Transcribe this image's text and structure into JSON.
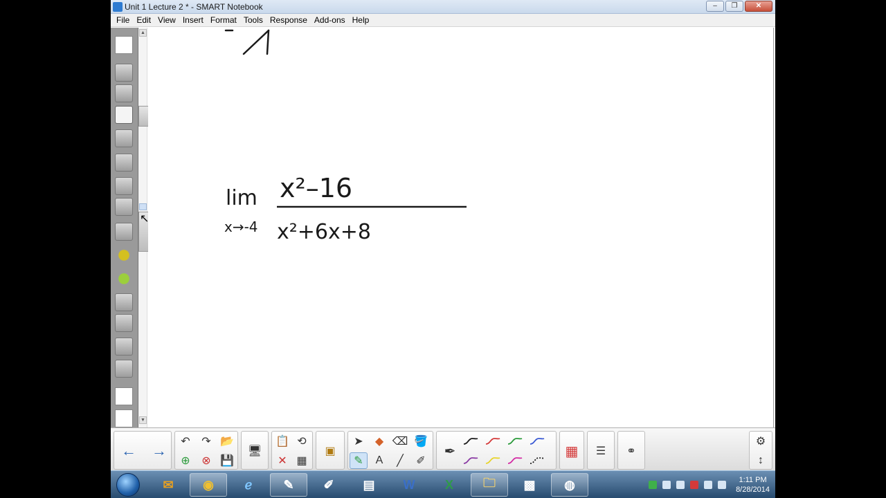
{
  "window": {
    "title": "Unit 1 Lecture 2 * - SMART Notebook",
    "minimize_symbol": "–",
    "maximize_symbol": "❐",
    "close_symbol": "✕"
  },
  "menu": [
    "File",
    "Edit",
    "View",
    "Insert",
    "Format",
    "Tools",
    "Response",
    "Add-ons",
    "Help"
  ],
  "canvas": {
    "top_sketch": "partial handwritten graph fragment",
    "expression": {
      "operator": "lim",
      "subscript": "x→-4",
      "numerator": "x²–16",
      "denominator": "x²+6x+8"
    }
  },
  "toolbar": {
    "nav": {
      "prev_icon": "arrow-left-icon",
      "next_icon": "arrow-right-icon"
    },
    "pen_colors": [
      "#1a1a1a",
      "#d43a3a",
      "#2a9a3a",
      "#3a5ad4",
      "#8a3aa4",
      "#e8d42a",
      "#d42aa4",
      "#1a1a1a"
    ]
  },
  "taskbar": {
    "time": "1:11 PM",
    "date": "8/28/2014",
    "word_label": "W",
    "excel_label": "X"
  }
}
